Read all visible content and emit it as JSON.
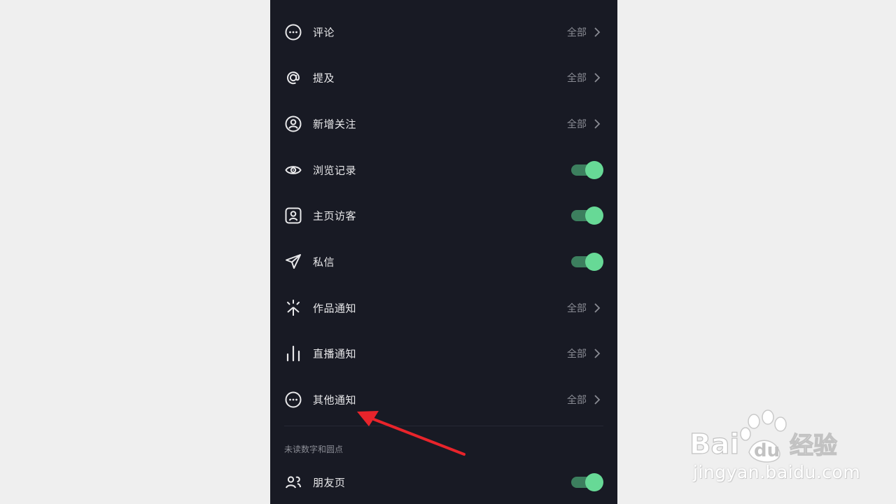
{
  "rows": [
    {
      "label": "评论",
      "value": "全部",
      "icon": "comment-icon"
    },
    {
      "label": "提及",
      "value": "全部",
      "icon": "at-icon"
    },
    {
      "label": "新增关注",
      "value": "全部",
      "icon": "user-circle-icon"
    },
    {
      "label": "浏览记录",
      "toggle": true,
      "icon": "eye-icon"
    },
    {
      "label": "主页访客",
      "toggle": true,
      "icon": "user-square-icon"
    },
    {
      "label": "私信",
      "toggle": true,
      "icon": "send-icon"
    },
    {
      "label": "作品通知",
      "value": "全部",
      "icon": "sparkle-icon"
    },
    {
      "label": "直播通知",
      "value": "全部",
      "icon": "bars-icon"
    },
    {
      "label": "其他通知",
      "value": "全部",
      "icon": "more-circle-icon"
    }
  ],
  "section": {
    "label": "未读数字和圆点"
  },
  "friend_row": {
    "label": "朋友页",
    "toggle": true,
    "icon": "friends-icon"
  },
  "watermark": {
    "brand": "Bai du 经验",
    "url": "jingyan.baidu.com"
  },
  "colors": {
    "background": "#181a24",
    "toggle_on": "#67d996",
    "arrow": "#e8242b"
  }
}
